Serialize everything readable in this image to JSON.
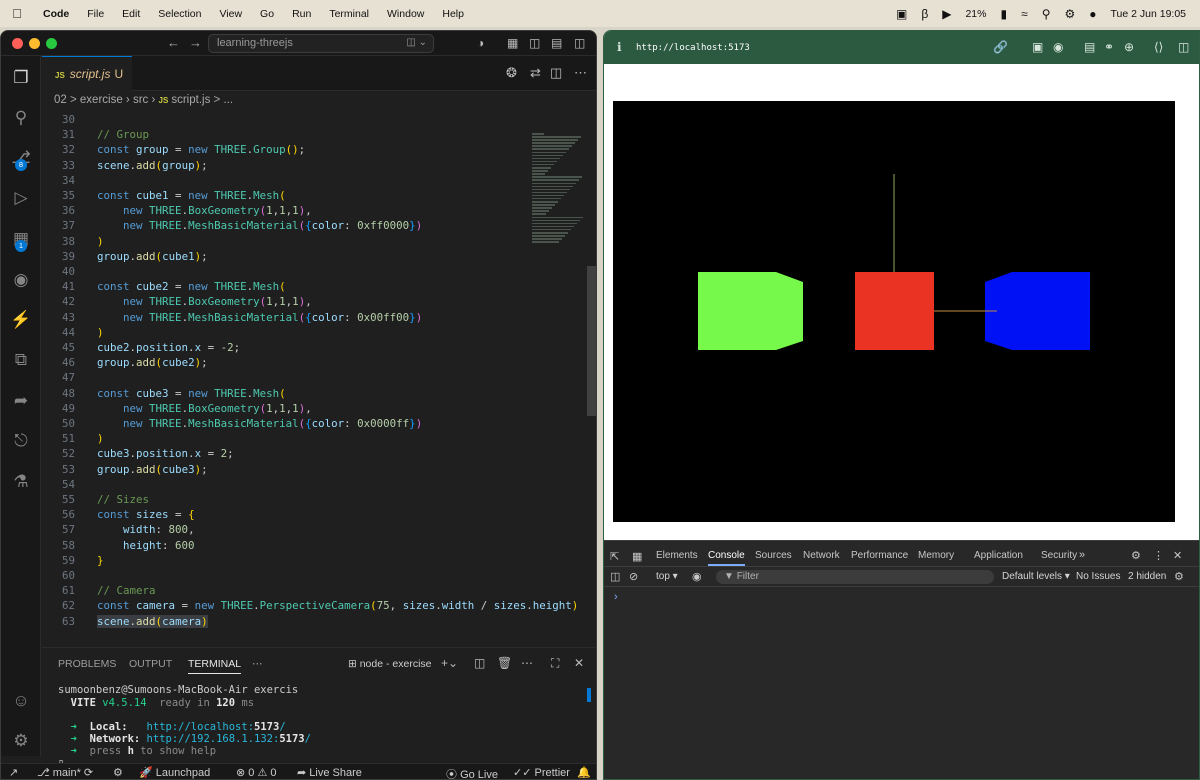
{
  "menubar": {
    "apple_icon": "apple-icon",
    "items": [
      "Code",
      "File",
      "Edit",
      "Selection",
      "View",
      "Go",
      "Run",
      "Terminal",
      "Window",
      "Help"
    ],
    "battery": "21%",
    "datetime": "Tue 2 Jun  19:05"
  },
  "vscode": {
    "search_text": "learning-threejs",
    "tab": {
      "icon_text": "JS",
      "label": "script.js",
      "status": "U"
    },
    "activity_badges": {
      "source_control": "8",
      "extensions": "1"
    },
    "breadcrumb": [
      "02 > exercise",
      "src",
      "JS",
      "script.js",
      "> ..."
    ],
    "code_lines": [
      {
        "n": "30",
        "html": ""
      },
      {
        "n": "31",
        "html": "<span class='com'>// Group</span>"
      },
      {
        "n": "32",
        "html": "<span class='kw'>const</span> <span class='var'>group</span> = <span class='kw'>new</span> <span class='cls'>THREE</span>.<span class='cls'>Group</span><span class='br1'>()</span>;"
      },
      {
        "n": "33",
        "html": "<span class='var'>scene</span>.<span class='fn'>add</span><span class='br1'>(</span><span class='var'>group</span><span class='br1'>)</span>;"
      },
      {
        "n": "34",
        "html": ""
      },
      {
        "n": "35",
        "html": "<span class='kw'>const</span> <span class='var'>cube1</span> = <span class='kw'>new</span> <span class='cls'>THREE</span>.<span class='cls'>Mesh</span><span class='br1'>(</span>"
      },
      {
        "n": "36",
        "html": "    <span class='kw'>new</span> <span class='cls'>THREE</span>.<span class='cls'>BoxGeometry</span><span class='br2'>(</span><span class='num'>1</span>,<span class='num'>1</span>,<span class='num'>1</span><span class='br2'>)</span>,"
      },
      {
        "n": "37",
        "html": "    <span class='kw'>new</span> <span class='cls'>THREE</span>.<span class='cls'>MeshBasicMaterial</span><span class='br2'>(</span><span class='br3'>{</span><span class='var'>color</span>: <span class='num'>0xff0000</span><span class='br3'>}</span><span class='br2'>)</span>"
      },
      {
        "n": "38",
        "html": "<span class='br1'>)</span>"
      },
      {
        "n": "39",
        "html": "<span class='var'>group</span>.<span class='fn'>add</span><span class='br1'>(</span><span class='var'>cube1</span><span class='br1'>)</span>;"
      },
      {
        "n": "40",
        "html": ""
      },
      {
        "n": "41",
        "html": "<span class='kw'>const</span> <span class='var'>cube2</span> = <span class='kw'>new</span> <span class='cls'>THREE</span>.<span class='cls'>Mesh</span><span class='br1'>(</span>"
      },
      {
        "n": "42",
        "html": "    <span class='kw'>new</span> <span class='cls'>THREE</span>.<span class='cls'>BoxGeometry</span><span class='br2'>(</span><span class='num'>1</span>,<span class='num'>1</span>,<span class='num'>1</span><span class='br2'>)</span>,"
      },
      {
        "n": "43",
        "html": "    <span class='kw'>new</span> <span class='cls'>THREE</span>.<span class='cls'>MeshBasicMaterial</span><span class='br2'>(</span><span class='br3'>{</span><span class='var'>color</span>: <span class='num'>0x00ff00</span><span class='br3'>}</span><span class='br2'>)</span>"
      },
      {
        "n": "44",
        "html": "<span class='br1'>)</span>"
      },
      {
        "n": "45",
        "html": "<span class='var'>cube2</span>.<span class='var'>position</span>.<span class='var'>x</span> = <span class='num'>-2</span>;"
      },
      {
        "n": "46",
        "html": "<span class='var'>group</span>.<span class='fn'>add</span><span class='br1'>(</span><span class='var'>cube2</span><span class='br1'>)</span>;"
      },
      {
        "n": "47",
        "html": ""
      },
      {
        "n": "48",
        "html": "<span class='kw'>const</span> <span class='var'>cube3</span> = <span class='kw'>new</span> <span class='cls'>THREE</span>.<span class='cls'>Mesh</span><span class='br1'>(</span>"
      },
      {
        "n": "49",
        "html": "    <span class='kw'>new</span> <span class='cls'>THREE</span>.<span class='cls'>BoxGeometry</span><span class='br2'>(</span><span class='num'>1</span>,<span class='num'>1</span>,<span class='num'>1</span><span class='br2'>)</span>,"
      },
      {
        "n": "50",
        "html": "    <span class='kw'>new</span> <span class='cls'>THREE</span>.<span class='cls'>MeshBasicMaterial</span><span class='br2'>(</span><span class='br3'>{</span><span class='var'>color</span>: <span class='num'>0x0000ff</span><span class='br3'>}</span><span class='br2'>)</span>"
      },
      {
        "n": "51",
        "html": "<span class='br1'>)</span>"
      },
      {
        "n": "52",
        "html": "<span class='var'>cube3</span>.<span class='var'>position</span>.<span class='var'>x</span> = <span class='num'>2</span>;"
      },
      {
        "n": "53",
        "html": "<span class='var'>group</span>.<span class='fn'>add</span><span class='br1'>(</span><span class='var'>cube3</span><span class='br1'>)</span>;"
      },
      {
        "n": "54",
        "html": ""
      },
      {
        "n": "55",
        "html": "<span class='com'>// Sizes</span>"
      },
      {
        "n": "56",
        "html": "<span class='kw'>const</span> <span class='var'>sizes</span> = <span class='br1'>{</span>"
      },
      {
        "n": "57",
        "html": "    <span class='var'>width</span>: <span class='num'>800</span>,"
      },
      {
        "n": "58",
        "html": "    <span class='var'>height</span>: <span class='num'>600</span>"
      },
      {
        "n": "59",
        "html": "<span class='br1'>}</span>"
      },
      {
        "n": "60",
        "html": ""
      },
      {
        "n": "61",
        "html": "<span class='com'>// Camera</span>"
      },
      {
        "n": "62",
        "html": "<span class='kw'>const</span> <span class='var'>camera</span> = <span class='kw'>new</span> <span class='cls'>THREE</span>.<span class='cls'>PerspectiveCamera</span><span class='br1'>(</span><span class='num'>75</span>, <span class='var'>sizes</span>.<span class='var'>width</span> / <span class='var'>sizes</span>.<span class='var'>height</span><span class='br1'>)</span>"
      },
      {
        "n": "63",
        "html": "<span class='var'>scene</span>.<span class='fn'>add</span><span class='br1'>(</span><span class='var'>camera</span><span class='br1'>)</span>"
      }
    ],
    "panel": {
      "tabs": [
        "PROBLEMS",
        "OUTPUT",
        "TERMINAL"
      ],
      "active_tab": "TERMINAL",
      "terminal_name": "node - exercise",
      "prompt": "sumoonbenz@Sumoons-MacBook-Air exercis",
      "vite_name": "VITE",
      "vite_version": "v4.5.14",
      "ready_text": "ready in",
      "ready_ms": "120",
      "ms_unit": "ms",
      "arrow": "➜",
      "local_label": "Local:",
      "local_url_prefix": "http://localhost:",
      "local_port": "5173",
      "url_suffix": "/",
      "network_label": "Network:",
      "network_url_prefix": "http://192.168.1.132:",
      "network_port": "5173",
      "help_prefix": "press",
      "help_key": "h",
      "help_suffix": "to show help"
    },
    "statusbar": {
      "branch": "main*",
      "launchpad": "Launchpad",
      "errors": "0",
      "warnings": "0",
      "live_share": "Live Share",
      "go_live": "Go Live",
      "prettier": "Prettier"
    }
  },
  "browser": {
    "url": "http://localhost:5173",
    "scene": {
      "cubes": [
        {
          "name": "cube-green",
          "color": "#76f94a"
        },
        {
          "name": "cube-red",
          "color": "#ea3323"
        },
        {
          "name": "cube-blue",
          "color": "#0012f5"
        }
      ],
      "axis_colors": {
        "y": "#8fa85a",
        "x": "#c28b3e"
      }
    },
    "devtools": {
      "tabs": [
        "Elements",
        "Console",
        "Sources",
        "Network",
        "Performance",
        "Memory",
        "Application",
        "Security"
      ],
      "active_tab": "Console",
      "context": "top",
      "filter_placeholder": "Filter",
      "levels": "Default levels",
      "issues": "No Issues",
      "hidden": "2 hidden",
      "prompt": "›"
    }
  }
}
